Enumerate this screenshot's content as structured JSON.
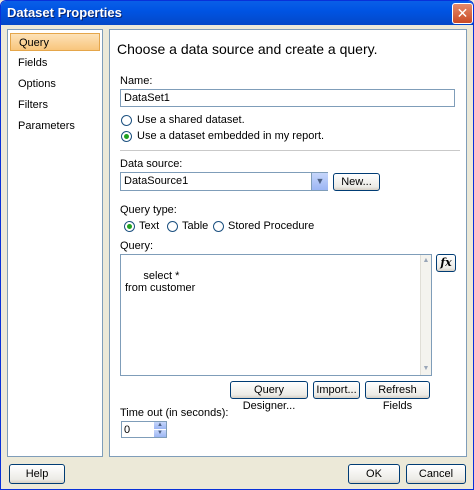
{
  "window": {
    "title": "Dataset Properties",
    "close_glyph": "✕"
  },
  "nav": {
    "items": [
      {
        "label": "Query"
      },
      {
        "label": "Fields"
      },
      {
        "label": "Options"
      },
      {
        "label": "Filters"
      },
      {
        "label": "Parameters"
      }
    ],
    "selected": "Query"
  },
  "query_page": {
    "heading": "Choose a data source and create a query.",
    "name_label": "Name:",
    "name_value": "DataSet1",
    "option_shared": "Use a shared dataset.",
    "option_embedded": "Use a dataset embedded in my report.",
    "selected_option": "embedded",
    "datasource_label": "Data source:",
    "datasource_value": "DataSource1",
    "new_button": "New...",
    "query_type_label": "Query type:",
    "query_types": [
      "Text",
      "Table",
      "Stored Procedure"
    ],
    "selected_query_type": "Text",
    "query_label": "Query:",
    "query_text": "select *\nfrom customer",
    "fx_label": "fx",
    "query_designer_button": "Query Designer...",
    "import_button": "Import...",
    "refresh_fields_button": "Refresh Fields",
    "timeout_label": "Time out (in seconds):",
    "timeout_value": "0"
  },
  "footer": {
    "help_button": "Help",
    "ok_button": "OK",
    "cancel_button": "Cancel"
  },
  "icons": {
    "dropdown": "chevron-down-icon",
    "spin_up": "arrow-up-icon",
    "spin_down": "arrow-down-icon"
  },
  "colors": {
    "title_bar": "#0054e3",
    "window_bg": "#ece9d8",
    "selected_nav": "#f8c57c",
    "radio_dot": "#21a121",
    "border": "#7f9db9"
  }
}
